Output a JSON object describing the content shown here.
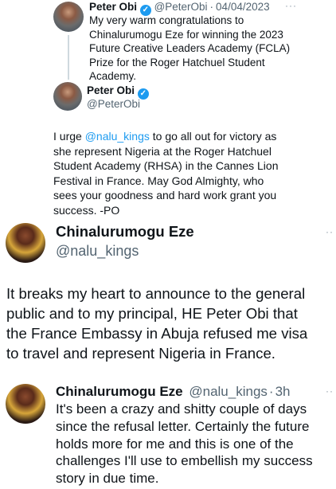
{
  "quoted_tweet": {
    "author": "Peter Obi",
    "handle": "@PeterObi",
    "date": "04/04/2023",
    "text_lines": [
      "My very warm congratulations to",
      "Chinalurumogu Eze for winning the 2023",
      "Future Creative Leaders Academy (FCLA)",
      "Prize for the Roger Hatchuel Student",
      "Academy."
    ]
  },
  "reply_tweet": {
    "author": "Peter Obi",
    "handle": "@PeterObi",
    "text_pre": "I urge ",
    "mention": "@nalu_kings",
    "text_lines": [
      " to go all out for victory as",
      "she represent Nigeria at the Roger Hatchuel",
      "Student Academy (RHSA) in the Cannes Lion",
      "Festival in France. May God Almighty, who",
      "sees your goodness and hard work grant you",
      "success. -PO"
    ]
  },
  "main_tweet": {
    "author": "Chinalurumogu Eze",
    "handle": "@nalu_kings",
    "text_lines": [
      "It breaks my heart to announce to the general",
      "public and to my principal, HE Peter Obi that",
      "the France Embassy in Abuja refused me visa",
      "to travel and represent Nigeria in France."
    ]
  },
  "bottom_tweet": {
    "author": "Chinalurumogu Eze",
    "handle": "@nalu_kings",
    "time": "3h",
    "text_lines": [
      "It's been a crazy and shitty couple of days",
      "since the refusal letter. Certainly the future",
      "holds more for me and this is one of the",
      "challenges I'll use to embellish my success",
      "story in due time."
    ]
  },
  "icons": {
    "verified": "verified-badge-icon",
    "more": "more-options-icon"
  },
  "colors": {
    "mention": "#1d9bf0",
    "muted": "#536471",
    "verified": "#1d9bf0"
  },
  "glyphs": {
    "more": "···",
    "more_small": "··",
    "check": "✓",
    "dot": "·"
  }
}
